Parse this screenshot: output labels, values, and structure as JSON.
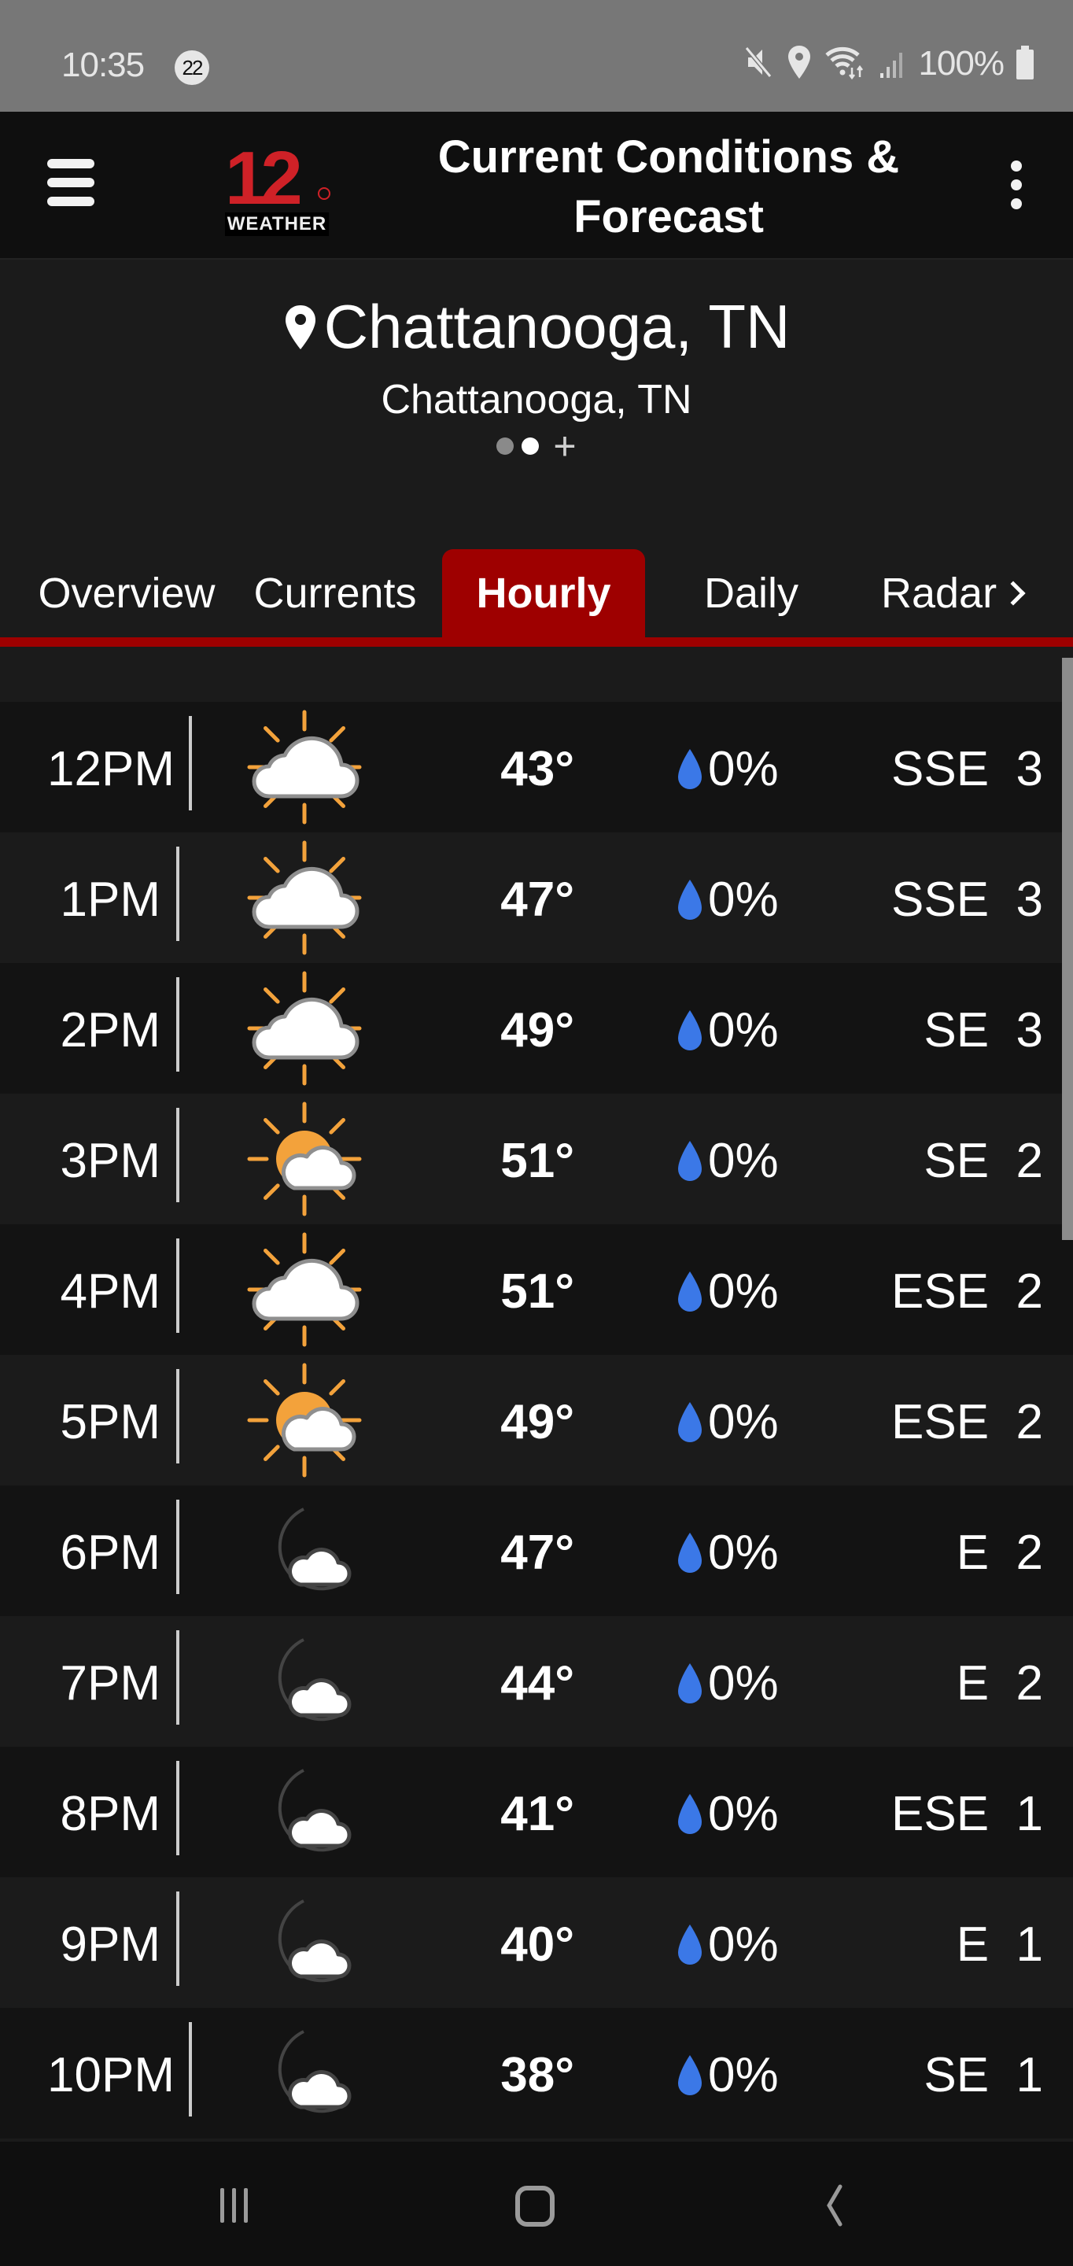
{
  "status_bar": {
    "time": "10:35",
    "notification_count": "22",
    "battery": "100%",
    "icons": [
      "mute-icon",
      "location-icon",
      "wifi-icon",
      "signal-icon",
      "battery-icon"
    ]
  },
  "app_bar": {
    "title": "Current Conditions & Forecast",
    "logo_number": "12",
    "logo_word": "WEATHER",
    "menu_icon": "hamburger-menu-icon",
    "more_icon": "more-vert-icon"
  },
  "location": {
    "name": "Chattanooga, TN",
    "subtitle": "Chattanooga, TN",
    "pages": 2,
    "active_page": 2,
    "add_label": "+"
  },
  "tabs": [
    {
      "label": "Overview",
      "active": false
    },
    {
      "label": "Currents",
      "active": false
    },
    {
      "label": "Hourly",
      "active": true
    },
    {
      "label": "Daily",
      "active": false
    },
    {
      "label": "Radar",
      "active": false
    }
  ],
  "colors": {
    "accent": "#9e0000",
    "logo_red": "#cf2127",
    "rain_drop": "#3b78e7",
    "sun": "#f3a23b",
    "moon": "#f9d66b"
  },
  "hourly": [
    {
      "time": "12PM",
      "icon": "mostly-cloudy-day-icon",
      "temp": "43°",
      "precip": "0%",
      "wind_dir": "SSE",
      "wind_speed": "3"
    },
    {
      "time": "1PM",
      "icon": "mostly-cloudy-day-icon",
      "temp": "47°",
      "precip": "0%",
      "wind_dir": "SSE",
      "wind_speed": "3"
    },
    {
      "time": "2PM",
      "icon": "mostly-cloudy-day-icon",
      "temp": "49°",
      "precip": "0%",
      "wind_dir": "SE",
      "wind_speed": "3"
    },
    {
      "time": "3PM",
      "icon": "partly-cloudy-day-icon",
      "temp": "51°",
      "precip": "0%",
      "wind_dir": "SE",
      "wind_speed": "2"
    },
    {
      "time": "4PM",
      "icon": "mostly-cloudy-day-icon",
      "temp": "51°",
      "precip": "0%",
      "wind_dir": "ESE",
      "wind_speed": "2"
    },
    {
      "time": "5PM",
      "icon": "partly-cloudy-day-icon",
      "temp": "49°",
      "precip": "0%",
      "wind_dir": "ESE",
      "wind_speed": "2"
    },
    {
      "time": "6PM",
      "icon": "partly-cloudy-night-icon",
      "temp": "47°",
      "precip": "0%",
      "wind_dir": "E",
      "wind_speed": "2"
    },
    {
      "time": "7PM",
      "icon": "partly-cloudy-night-icon",
      "temp": "44°",
      "precip": "0%",
      "wind_dir": "E",
      "wind_speed": "2"
    },
    {
      "time": "8PM",
      "icon": "partly-cloudy-night-icon",
      "temp": "41°",
      "precip": "0%",
      "wind_dir": "ESE",
      "wind_speed": "1"
    },
    {
      "time": "9PM",
      "icon": "partly-cloudy-night-icon",
      "temp": "40°",
      "precip": "0%",
      "wind_dir": "E",
      "wind_speed": "1"
    },
    {
      "time": "10PM",
      "icon": "partly-cloudy-night-icon",
      "temp": "38°",
      "precip": "0%",
      "wind_dir": "SE",
      "wind_speed": "1"
    }
  ],
  "nav_bar": {
    "buttons": [
      "recent-apps-icon",
      "home-icon",
      "back-icon"
    ]
  }
}
